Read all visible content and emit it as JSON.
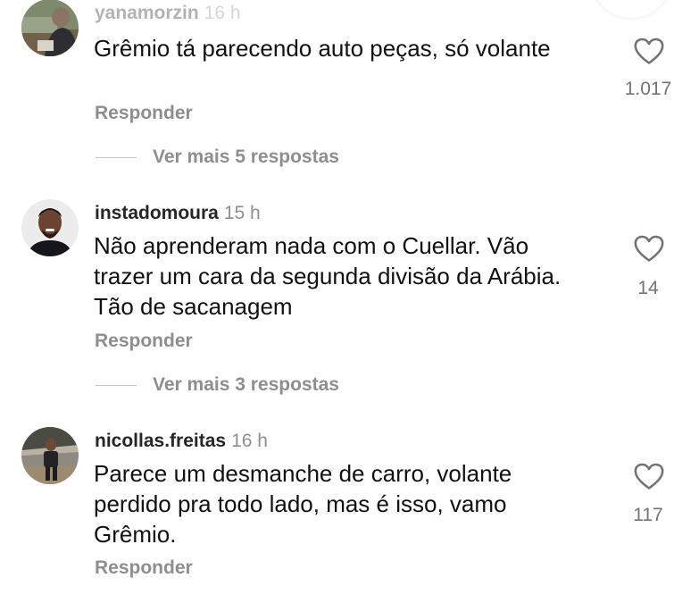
{
  "comments": [
    {
      "username": "yanamorzin",
      "time": "16 h",
      "text": "Grêmio tá parecendo auto peças, só volante",
      "likes": "1.017",
      "reply_label": "Responder",
      "more_replies": "Ver mais 5 respostas",
      "avatar_icon": "avatar-photo"
    },
    {
      "username": "instadomoura",
      "time": "15 h",
      "text": "Não aprenderam nada com o Cuellar. Vão trazer um cara da segunda divisão da Arábia. Tão de sacanagem",
      "likes": "14",
      "reply_label": "Responder",
      "more_replies": "Ver mais 3 respostas",
      "avatar_icon": "avatar-photo"
    },
    {
      "username": "nicollas.freitas",
      "time": "16 h",
      "text": "Parece um desmanche de carro, volante perdido pra todo lado, mas é isso, vamo Grêmio.",
      "likes": "117",
      "reply_label": "Responder",
      "avatar_icon": "avatar-photo"
    }
  ],
  "icons": {
    "like": "heart-outline-icon"
  },
  "colors": {
    "text": "#111111",
    "secondary": "#8e8e8e",
    "username": "#262626"
  }
}
